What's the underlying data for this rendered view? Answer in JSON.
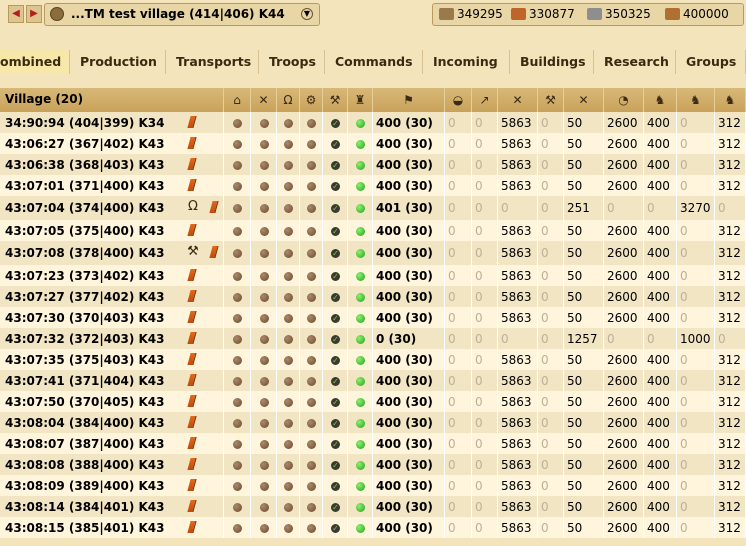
{
  "topbar": {
    "prev_label": "◀",
    "next_label": "▶",
    "village_label": "...TM test village  (414|406) K44",
    "resources": [
      {
        "name": "wood",
        "value": "349295",
        "color": "#9a7a4a"
      },
      {
        "name": "clay",
        "value": "330877",
        "color": "#c0652a"
      },
      {
        "name": "iron",
        "value": "350325",
        "color": "#8e8e8e"
      },
      {
        "name": "storage",
        "value": "400000",
        "color": "#b07030"
      }
    ]
  },
  "tabs": [
    "ombined",
    "Production",
    "Transports",
    "Troops",
    "Commands",
    "Incoming",
    "Buildings",
    "Research",
    "Groups"
  ],
  "active_tab": 0,
  "table": {
    "village_header": "Village (20)",
    "header_icons": [
      "farm-header-icon",
      "smith-header-icon",
      "snob-header-icon",
      "workshop-header-icon",
      "barracks-header-icon",
      "statue-header-icon",
      "flag-header-icon",
      "resource-header-icon",
      "spear-header-icon",
      "sword-header-icon",
      "axe-header-icon",
      "archer-header-icon",
      "spy-header-icon",
      "light-cavalry-header-icon",
      "mounted-archer-header-icon",
      "heavy-cavalry-header-icon",
      "ram-header-icon"
    ],
    "rows": [
      {
        "name": "34:90:94 (404|399) K34",
        "edit": true,
        "building": "",
        "res": "400 (30)",
        "u": [
          "0",
          "0",
          "5863",
          "0",
          "50",
          "2600",
          "400",
          "0",
          "312"
        ]
      },
      {
        "name": "43:06:27 (367|402) K43",
        "edit": true,
        "building": "",
        "res": "400 (30)",
        "u": [
          "0",
          "0",
          "5863",
          "0",
          "50",
          "2600",
          "400",
          "0",
          "312"
        ]
      },
      {
        "name": "43:06:38 (368|403) K43",
        "edit": true,
        "building": "",
        "res": "400 (30)",
        "u": [
          "0",
          "0",
          "5863",
          "0",
          "50",
          "2600",
          "400",
          "0",
          "312"
        ]
      },
      {
        "name": "43:07:01 (371|400) K43",
        "edit": true,
        "building": "",
        "res": "400 (30)",
        "u": [
          "0",
          "0",
          "5863",
          "0",
          "50",
          "2600",
          "400",
          "0",
          "312"
        ]
      },
      {
        "name": "43:07:04 (374|400) K43",
        "edit": true,
        "building": "horseshoe",
        "res": "401 (30)",
        "u": [
          "0",
          "0",
          "0",
          "0",
          "251",
          "0",
          "0",
          "3270",
          "0"
        ]
      },
      {
        "name": "43:07:05 (375|400) K43",
        "edit": true,
        "building": "",
        "res": "400 (30)",
        "u": [
          "0",
          "0",
          "5863",
          "0",
          "50",
          "2600",
          "400",
          "0",
          "312"
        ]
      },
      {
        "name": "43:07:08 (378|400) K43",
        "edit": true,
        "building": "hammer",
        "res": "400 (30)",
        "u": [
          "0",
          "0",
          "5863",
          "0",
          "50",
          "2600",
          "400",
          "0",
          "312"
        ]
      },
      {
        "name": "43:07:23 (373|402) K43",
        "edit": true,
        "building": "",
        "res": "400 (30)",
        "u": [
          "0",
          "0",
          "5863",
          "0",
          "50",
          "2600",
          "400",
          "0",
          "312"
        ]
      },
      {
        "name": "43:07:27 (377|402) K43",
        "edit": true,
        "building": "",
        "res": "400 (30)",
        "u": [
          "0",
          "0",
          "5863",
          "0",
          "50",
          "2600",
          "400",
          "0",
          "312"
        ]
      },
      {
        "name": "43:07:30 (370|403) K43",
        "edit": true,
        "building": "",
        "res": "400 (30)",
        "u": [
          "0",
          "0",
          "5863",
          "0",
          "50",
          "2600",
          "400",
          "0",
          "312"
        ]
      },
      {
        "name": "43:07:32 (372|403) K43",
        "edit": true,
        "building": "",
        "res": "0 (30)",
        "u": [
          "0",
          "0",
          "0",
          "0",
          "1257",
          "0",
          "0",
          "1000",
          "0"
        ]
      },
      {
        "name": "43:07:35 (375|403) K43",
        "edit": true,
        "building": "",
        "res": "400 (30)",
        "u": [
          "0",
          "0",
          "5863",
          "0",
          "50",
          "2600",
          "400",
          "0",
          "312"
        ]
      },
      {
        "name": "43:07:41 (371|404) K43",
        "edit": true,
        "building": "",
        "res": "400 (30)",
        "u": [
          "0",
          "0",
          "5863",
          "0",
          "50",
          "2600",
          "400",
          "0",
          "312"
        ]
      },
      {
        "name": "43:07:50 (370|405) K43",
        "edit": true,
        "building": "",
        "res": "400 (30)",
        "u": [
          "0",
          "0",
          "5863",
          "0",
          "50",
          "2600",
          "400",
          "0",
          "312"
        ]
      },
      {
        "name": "43:08:04 (384|400) K43",
        "edit": true,
        "building": "",
        "res": "400 (30)",
        "u": [
          "0",
          "0",
          "5863",
          "0",
          "50",
          "2600",
          "400",
          "0",
          "312"
        ]
      },
      {
        "name": "43:08:07 (387|400) K43",
        "edit": true,
        "building": "",
        "res": "400 (30)",
        "u": [
          "0",
          "0",
          "5863",
          "0",
          "50",
          "2600",
          "400",
          "0",
          "312"
        ]
      },
      {
        "name": "43:08:08 (388|400) K43",
        "edit": true,
        "building": "",
        "res": "400 (30)",
        "u": [
          "0",
          "0",
          "5863",
          "0",
          "50",
          "2600",
          "400",
          "0",
          "312"
        ]
      },
      {
        "name": "43:08:09 (389|400) K43",
        "edit": true,
        "building": "",
        "res": "400 (30)",
        "u": [
          "0",
          "0",
          "5863",
          "0",
          "50",
          "2600",
          "400",
          "0",
          "312"
        ]
      },
      {
        "name": "43:08:14 (384|401) K43",
        "edit": true,
        "building": "",
        "res": "400 (30)",
        "u": [
          "0",
          "0",
          "5863",
          "0",
          "50",
          "2600",
          "400",
          "0",
          "312"
        ]
      },
      {
        "name": "43:08:15 (385|401) K43",
        "edit": true,
        "building": "",
        "res": "400 (30)",
        "u": [
          "0",
          "0",
          "5863",
          "0",
          "50",
          "2600",
          "400",
          "0",
          "312"
        ]
      }
    ]
  }
}
